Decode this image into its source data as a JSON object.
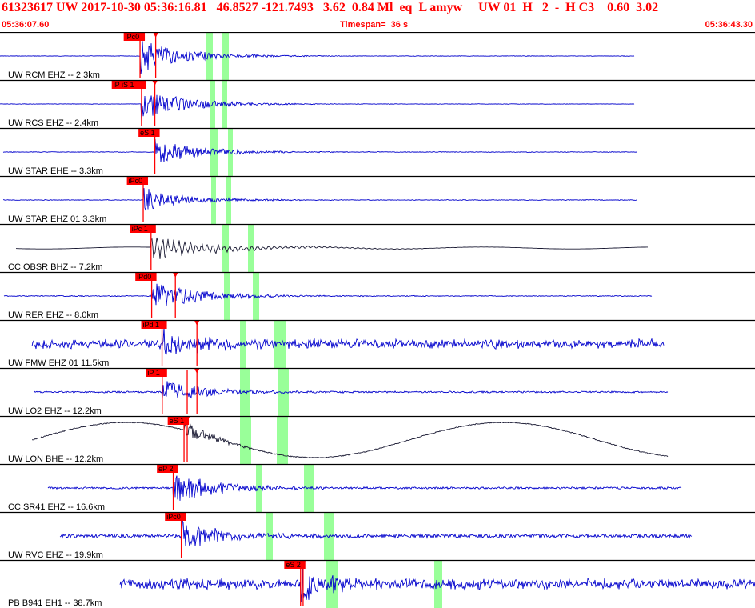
{
  "header": {
    "event_line": "61323617 UW 2017-10-30 05:36:16.81   46.8527 -121.7493   3.62  0.84 Ml  eq  L amyw     UW 01  H   2  -  H C3    0.60  3.02",
    "start_time": "05:36:07.60",
    "timespan": "Timespan=  36 s",
    "end_time": "05:36:43.30"
  },
  "colors": {
    "header_text": "#ff0000",
    "trace_blue": "#0000cc",
    "trace_black": "#1a1a33",
    "pick_marker": "#ff0000",
    "pick_window": "#99ff99",
    "separator": "#000000"
  },
  "traces": [
    {
      "label": "UW RCM EHZ -- 2.3km",
      "color": "blue",
      "picks": [
        "iPc0"
      ],
      "pick_arrival_s": [
        6.62,
        7.36
      ]
    },
    {
      "label": "UW RCS EHZ -- 2.4km",
      "color": "blue",
      "picks": [
        "iP iS 1"
      ],
      "pick_arrival_s": [
        6.69,
        7.32
      ]
    },
    {
      "label": "UW STAR EHE -- 3.3km",
      "color": "blue",
      "picks": [
        "eS 1"
      ],
      "pick_arrival_s": [
        7.32
      ]
    },
    {
      "label": "UW STAR EHZ 01 3.3km",
      "color": "blue",
      "picks": [
        "iPc0"
      ],
      "pick_arrival_s": [
        6.77
      ]
    },
    {
      "label": "CC OBSR BHZ -- 7.2km",
      "color": "black",
      "picks": [
        "iPc 1"
      ],
      "pick_arrival_s": [
        7.14
      ]
    },
    {
      "label": "UW RER EHZ -- 8.0km",
      "color": "blue",
      "picks": [
        "iPd0"
      ],
      "pick_arrival_s": [
        7.17,
        8.29
      ]
    },
    {
      "label": "UW FMW EHZ 01 11.5km",
      "color": "blue",
      "picks": [
        "iPd 1"
      ],
      "pick_arrival_s": [
        7.66,
        9.31
      ]
    },
    {
      "label": "UW LO2 EHZ -- 12.2km",
      "color": "blue",
      "picks": [
        "iP 1"
      ],
      "pick_arrival_s": [
        7.67,
        8.85,
        9.31
      ]
    },
    {
      "label": "UW LON BHE -- 12.2km",
      "color": "black",
      "picks": [
        "eS 1"
      ],
      "pick_arrival_s": [
        8.7,
        8.85
      ]
    },
    {
      "label": "CC SR41 EHZ -- 16.6km",
      "color": "blue",
      "picks": [
        "eP 2"
      ],
      "pick_arrival_s": [
        8.19
      ]
    },
    {
      "label": "UW RVC EHZ -- 19.9km",
      "color": "blue",
      "picks": [
        "iPc0"
      ],
      "pick_arrival_s": [
        8.57
      ]
    },
    {
      "label": "PB B941 EH1 -- 38.7km",
      "color": "blue",
      "picks": [
        "eS 2"
      ],
      "pick_arrival_s": [
        14.21,
        14.33
      ]
    }
  ]
}
